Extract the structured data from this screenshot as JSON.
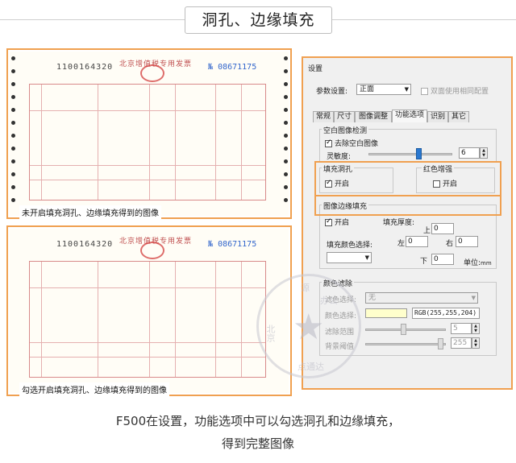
{
  "header": {
    "title": "洞孔、边缘填充"
  },
  "invoice_top": {
    "number": "1100164320",
    "name": "北京增值税专用发票",
    "no_prefix": "№",
    "no": "08671175",
    "caption": "未开启填充洞孔、边缘填充得到的图像"
  },
  "invoice_bottom": {
    "number": "1100164320",
    "name": "北京增值税专用发票",
    "no_prefix": "№",
    "no": "08671175",
    "caption": "勾选开启填充洞孔、边缘填充得到的图像"
  },
  "dialog": {
    "title": "设置",
    "param_label": "参数设置:",
    "param_value": "正面",
    "duplex_label": "双面使用相同配置",
    "tabs": [
      "常规",
      "尺寸",
      "图像调整",
      "功能选项",
      "识别",
      "其它"
    ],
    "active_tab": "功能选项",
    "blank_group": "空白图像检测",
    "remove_blank": "去除空白图像",
    "sensitivity_label": "灵敏度:",
    "sensitivity_value": "6",
    "sensitivity_level": 0.6,
    "hole_group": "填充洞孔",
    "hole_enable": "开启",
    "red_group": "红色增强",
    "red_enable": "开启",
    "edge_group": "图像边缘填充",
    "edge_enable": "开启",
    "thickness_label": "填充厚度:",
    "top_label": "上",
    "top_value": "0",
    "left_label": "左",
    "left_value": "0",
    "right_label": "右",
    "right_value": "0",
    "bottom_label": "下",
    "bottom_value": "0",
    "unit_label": "单位:",
    "unit_value": "mm",
    "fill_color_label": "填充颜色选择:",
    "dropout_group": "颜色滤除",
    "dropout_select_label": "滤色选择:",
    "dropout_select_value": "无",
    "color_pick_label": "颜色选择:",
    "rgb_value": "RGB(255,255,204)",
    "range_label": "滤除范围",
    "range_value": "5",
    "bg_label": "背景阈值",
    "bg_value": "255",
    "colors": {
      "accent": "#f0a050",
      "slider": "#2a78d0",
      "swatch": "#ffffcc"
    }
  },
  "watermark": {
    "text1": "北京",
    "text2": "源",
    "text3": "办公",
    "text4": "点通达"
  },
  "footer": {
    "line1": "F500在设置，功能选项中可以勾选洞孔和边缘填充，",
    "line2": "得到完整图像"
  }
}
